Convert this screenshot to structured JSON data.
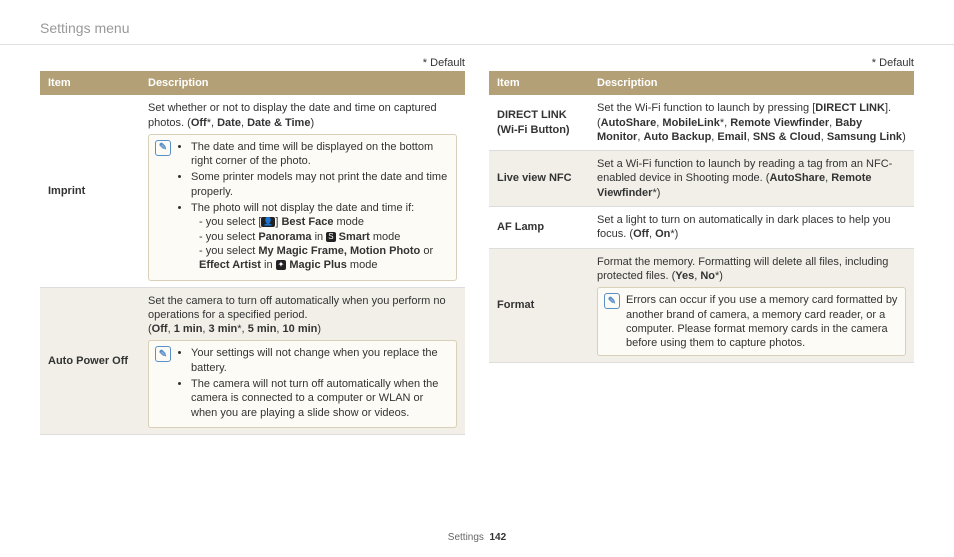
{
  "header": {
    "title": "Settings menu"
  },
  "default_note": "* Default",
  "table": {
    "col_item": "Item",
    "col_desc": "Description"
  },
  "left": {
    "r0": {
      "item": "Imprint",
      "intro": "Set whether or not to display the date and time on captured photos. (",
      "opt1": "Off",
      "sep1": "*, ",
      "opt2": "Date",
      "sep2": ", ",
      "opt3": "Date & Time",
      "close": ")",
      "note1": "The date and time will be displayed on the bottom right corner of the photo.",
      "note2": "Some printer models may not print the date and time properly.",
      "note3_pre": "The photo will not display the date and time if:",
      "d1_pre": "you select [",
      "d1_icon": "👤",
      "d1_post": "] ",
      "d1_bold": "Best Face",
      "d1_tail": " mode",
      "d2_pre": "you select ",
      "d2_bold": "Panorama",
      "d2_mid": " in ",
      "d2_icon": "S",
      "d2_bold2": " Smart",
      "d2_tail": " mode",
      "d3_pre": "you select ",
      "d3_bold": "My Magic Frame, Motion Photo",
      "d3_mid": " or ",
      "d3_bold2": "Effect Artist",
      "d3_mid2": " in ",
      "d3_icon": "✦",
      "d3_bold3": " Magic Plus",
      "d3_tail": " mode"
    },
    "r1": {
      "item": "Auto Power Off",
      "intro": "Set the camera to turn off automatically when you perform no operations for a specified period.",
      "opts_open": "(",
      "o1": "Off",
      "s1": ", ",
      "o2": "1 min",
      "s2": ", ",
      "o3": "3 min",
      "s3": "*, ",
      "o4": "5 min",
      "s4": ", ",
      "o5": "10 min",
      "close": ")",
      "note1": "Your settings will not change when you replace the battery.",
      "note2": "The camera will not turn off automatically when the camera is connected to a computer or WLAN or when you are playing a slide show or videos."
    }
  },
  "right": {
    "r0": {
      "item": "DIRECT LINK (Wi-Fi Button)",
      "pre": "Set the Wi-Fi function to launch by pressing [",
      "dl": "DIRECT LINK",
      "post": "]. (",
      "o1": "AutoShare",
      "s1": ", ",
      "o2": "MobileLink",
      "s2": "*, ",
      "o3": "Remote Viewfinder",
      "s3": ", ",
      "o4": "Baby Monitor",
      "s4": ", ",
      "o5": "Auto Backup",
      "s5": ", ",
      "o6": "Email",
      "s6": ", ",
      "o7": "SNS & Cloud",
      "s7": ", ",
      "o8": "Samsung Link",
      "close": ")"
    },
    "r1": {
      "item": "Live view NFC",
      "pre": "Set a Wi-Fi function to launch by reading a tag from an NFC-enabled device in Shooting mode. (",
      "o1": "AutoShare",
      "s1": ", ",
      "o2": "Remote Viewfinder",
      "close": "*)"
    },
    "r2": {
      "item": "AF Lamp",
      "pre": "Set a light to turn on automatically in dark places to help you focus. (",
      "o1": "Off",
      "s1": ", ",
      "o2": "On",
      "close": "*)"
    },
    "r3": {
      "item": "Format",
      "pre": "Format the memory. Formatting will delete all files, including protected files. (",
      "o1": "Yes",
      "s1": ", ",
      "o2": "No",
      "close": "*)",
      "note1": "Errors can occur if you use a memory card formatted by another brand of camera, a memory card reader, or a computer. Please format memory cards in the camera before using them to capture photos."
    }
  },
  "footer": {
    "section": "Settings",
    "page": "142"
  }
}
